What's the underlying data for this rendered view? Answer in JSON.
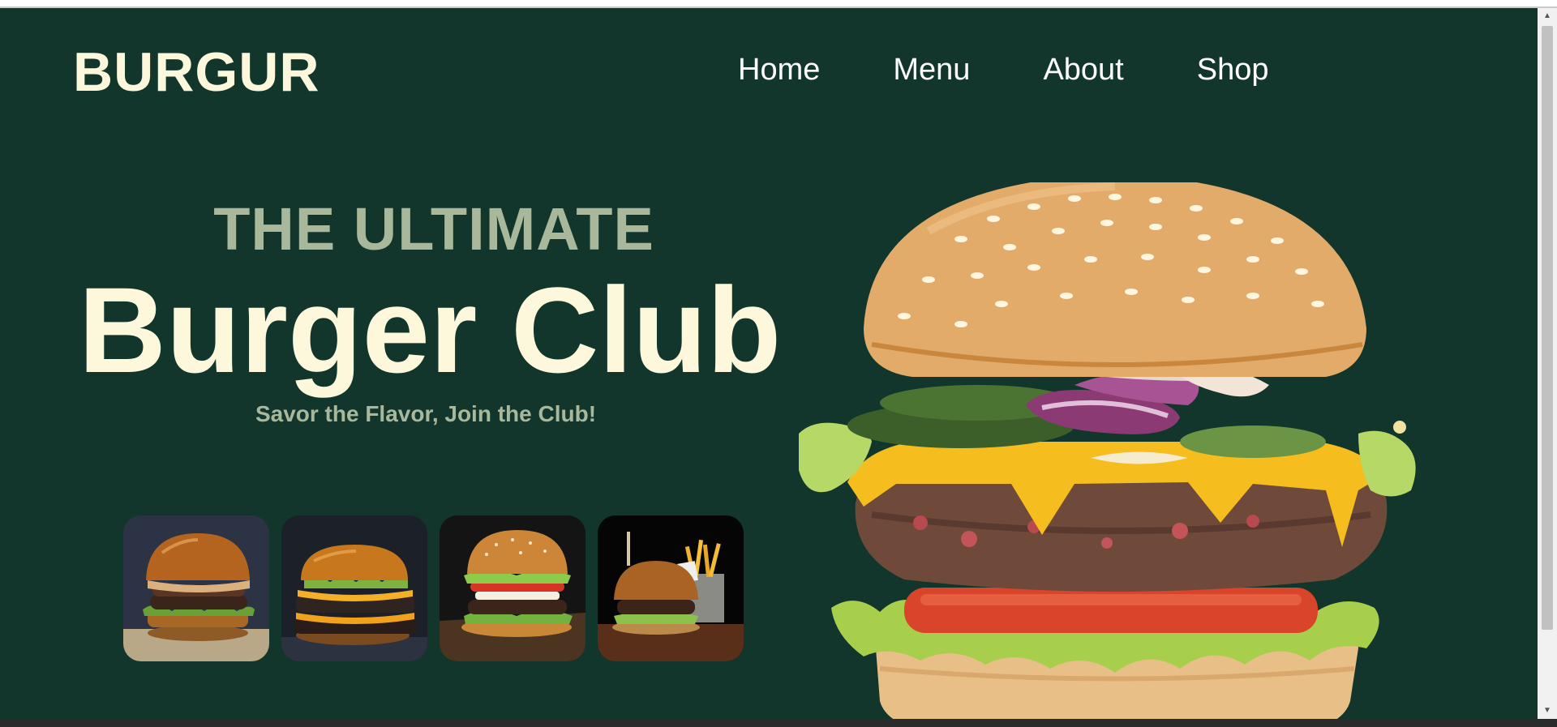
{
  "brand": {
    "logo": "BURGUR"
  },
  "nav": {
    "items": [
      {
        "label": "Home"
      },
      {
        "label": "Menu"
      },
      {
        "label": "About"
      },
      {
        "label": "Shop"
      }
    ]
  },
  "hero": {
    "eyebrow": "THE ULTIMATE",
    "headline": "Burger Club",
    "tagline": "Savor the Flavor, Join the Club!"
  },
  "thumbnails": [
    {
      "icon": "cheeseburger-photo"
    },
    {
      "icon": "double-burger-photo"
    },
    {
      "icon": "classic-burger-photo"
    },
    {
      "icon": "burger-with-fries-photo"
    }
  ],
  "colors": {
    "background": "#12362c",
    "cream": "#fdf8dc",
    "sage": "#a9b89b"
  }
}
